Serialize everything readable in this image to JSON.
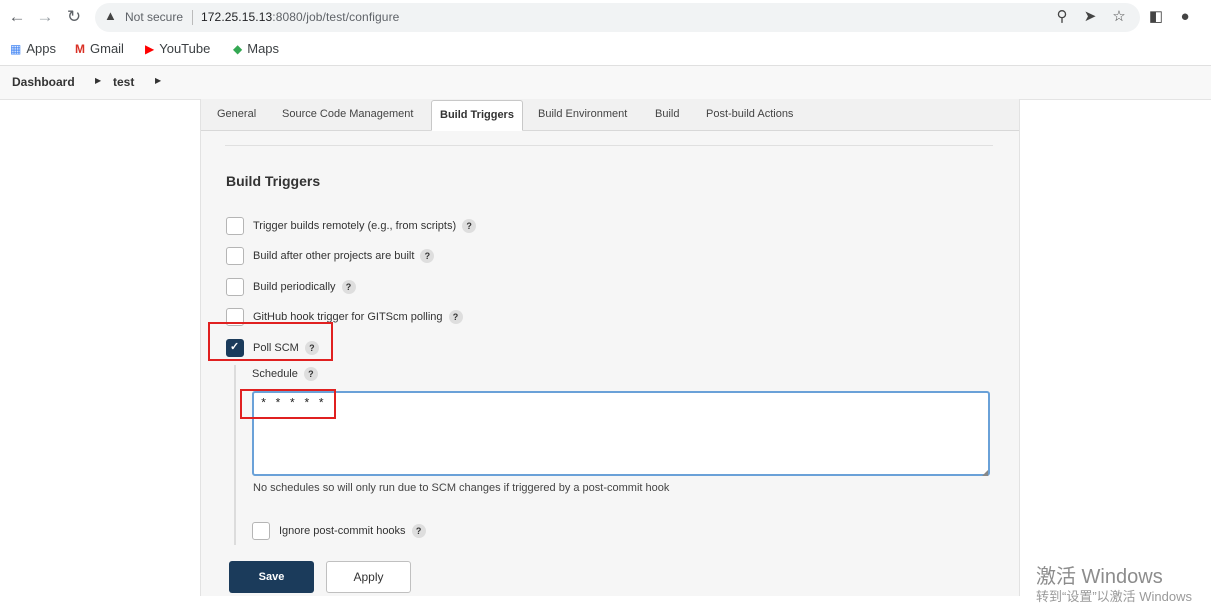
{
  "browser": {
    "security_label": "Not secure",
    "url_host": "172.25.15.13",
    "url_rest": ":8080/job/test/configure",
    "bookmarks": [
      {
        "label": "Apps",
        "icon": "apps-grid-icon"
      },
      {
        "label": "Gmail",
        "icon": "gmail-icon"
      },
      {
        "label": "YouTube",
        "icon": "youtube-icon"
      },
      {
        "label": "Maps",
        "icon": "maps-icon"
      }
    ]
  },
  "breadcrumb": {
    "items": [
      "Dashboard",
      "test"
    ]
  },
  "tabs": [
    "General",
    "Source Code Management",
    "Build Triggers",
    "Build Environment",
    "Build",
    "Post-build Actions"
  ],
  "active_tab": "Build Triggers",
  "section": {
    "title": "Build Triggers",
    "triggers": [
      {
        "label": "Trigger builds remotely (e.g., from scripts)",
        "checked": false
      },
      {
        "label": "Build after other projects are built",
        "checked": false
      },
      {
        "label": "Build periodically",
        "checked": false
      },
      {
        "label": "GitHub hook trigger for GITScm polling",
        "checked": false
      },
      {
        "label": "Poll SCM",
        "checked": true
      }
    ],
    "schedule": {
      "label": "Schedule",
      "value": "* * * * *",
      "note": "No schedules so will only run due to SCM changes if triggered by a post-commit hook"
    },
    "ignore_hooks": {
      "label": "Ignore post-commit hooks",
      "checked": false
    },
    "help_glyph": "?"
  },
  "actions": {
    "save": "Save",
    "apply": "Apply"
  },
  "watermark": {
    "line1": "激活 Windows",
    "line2": "转到“设置”以激活 Windows"
  },
  "colors": {
    "accent": "#1b3b5b",
    "highlight": "#e02020",
    "input_focus": "#6aa1d8"
  }
}
